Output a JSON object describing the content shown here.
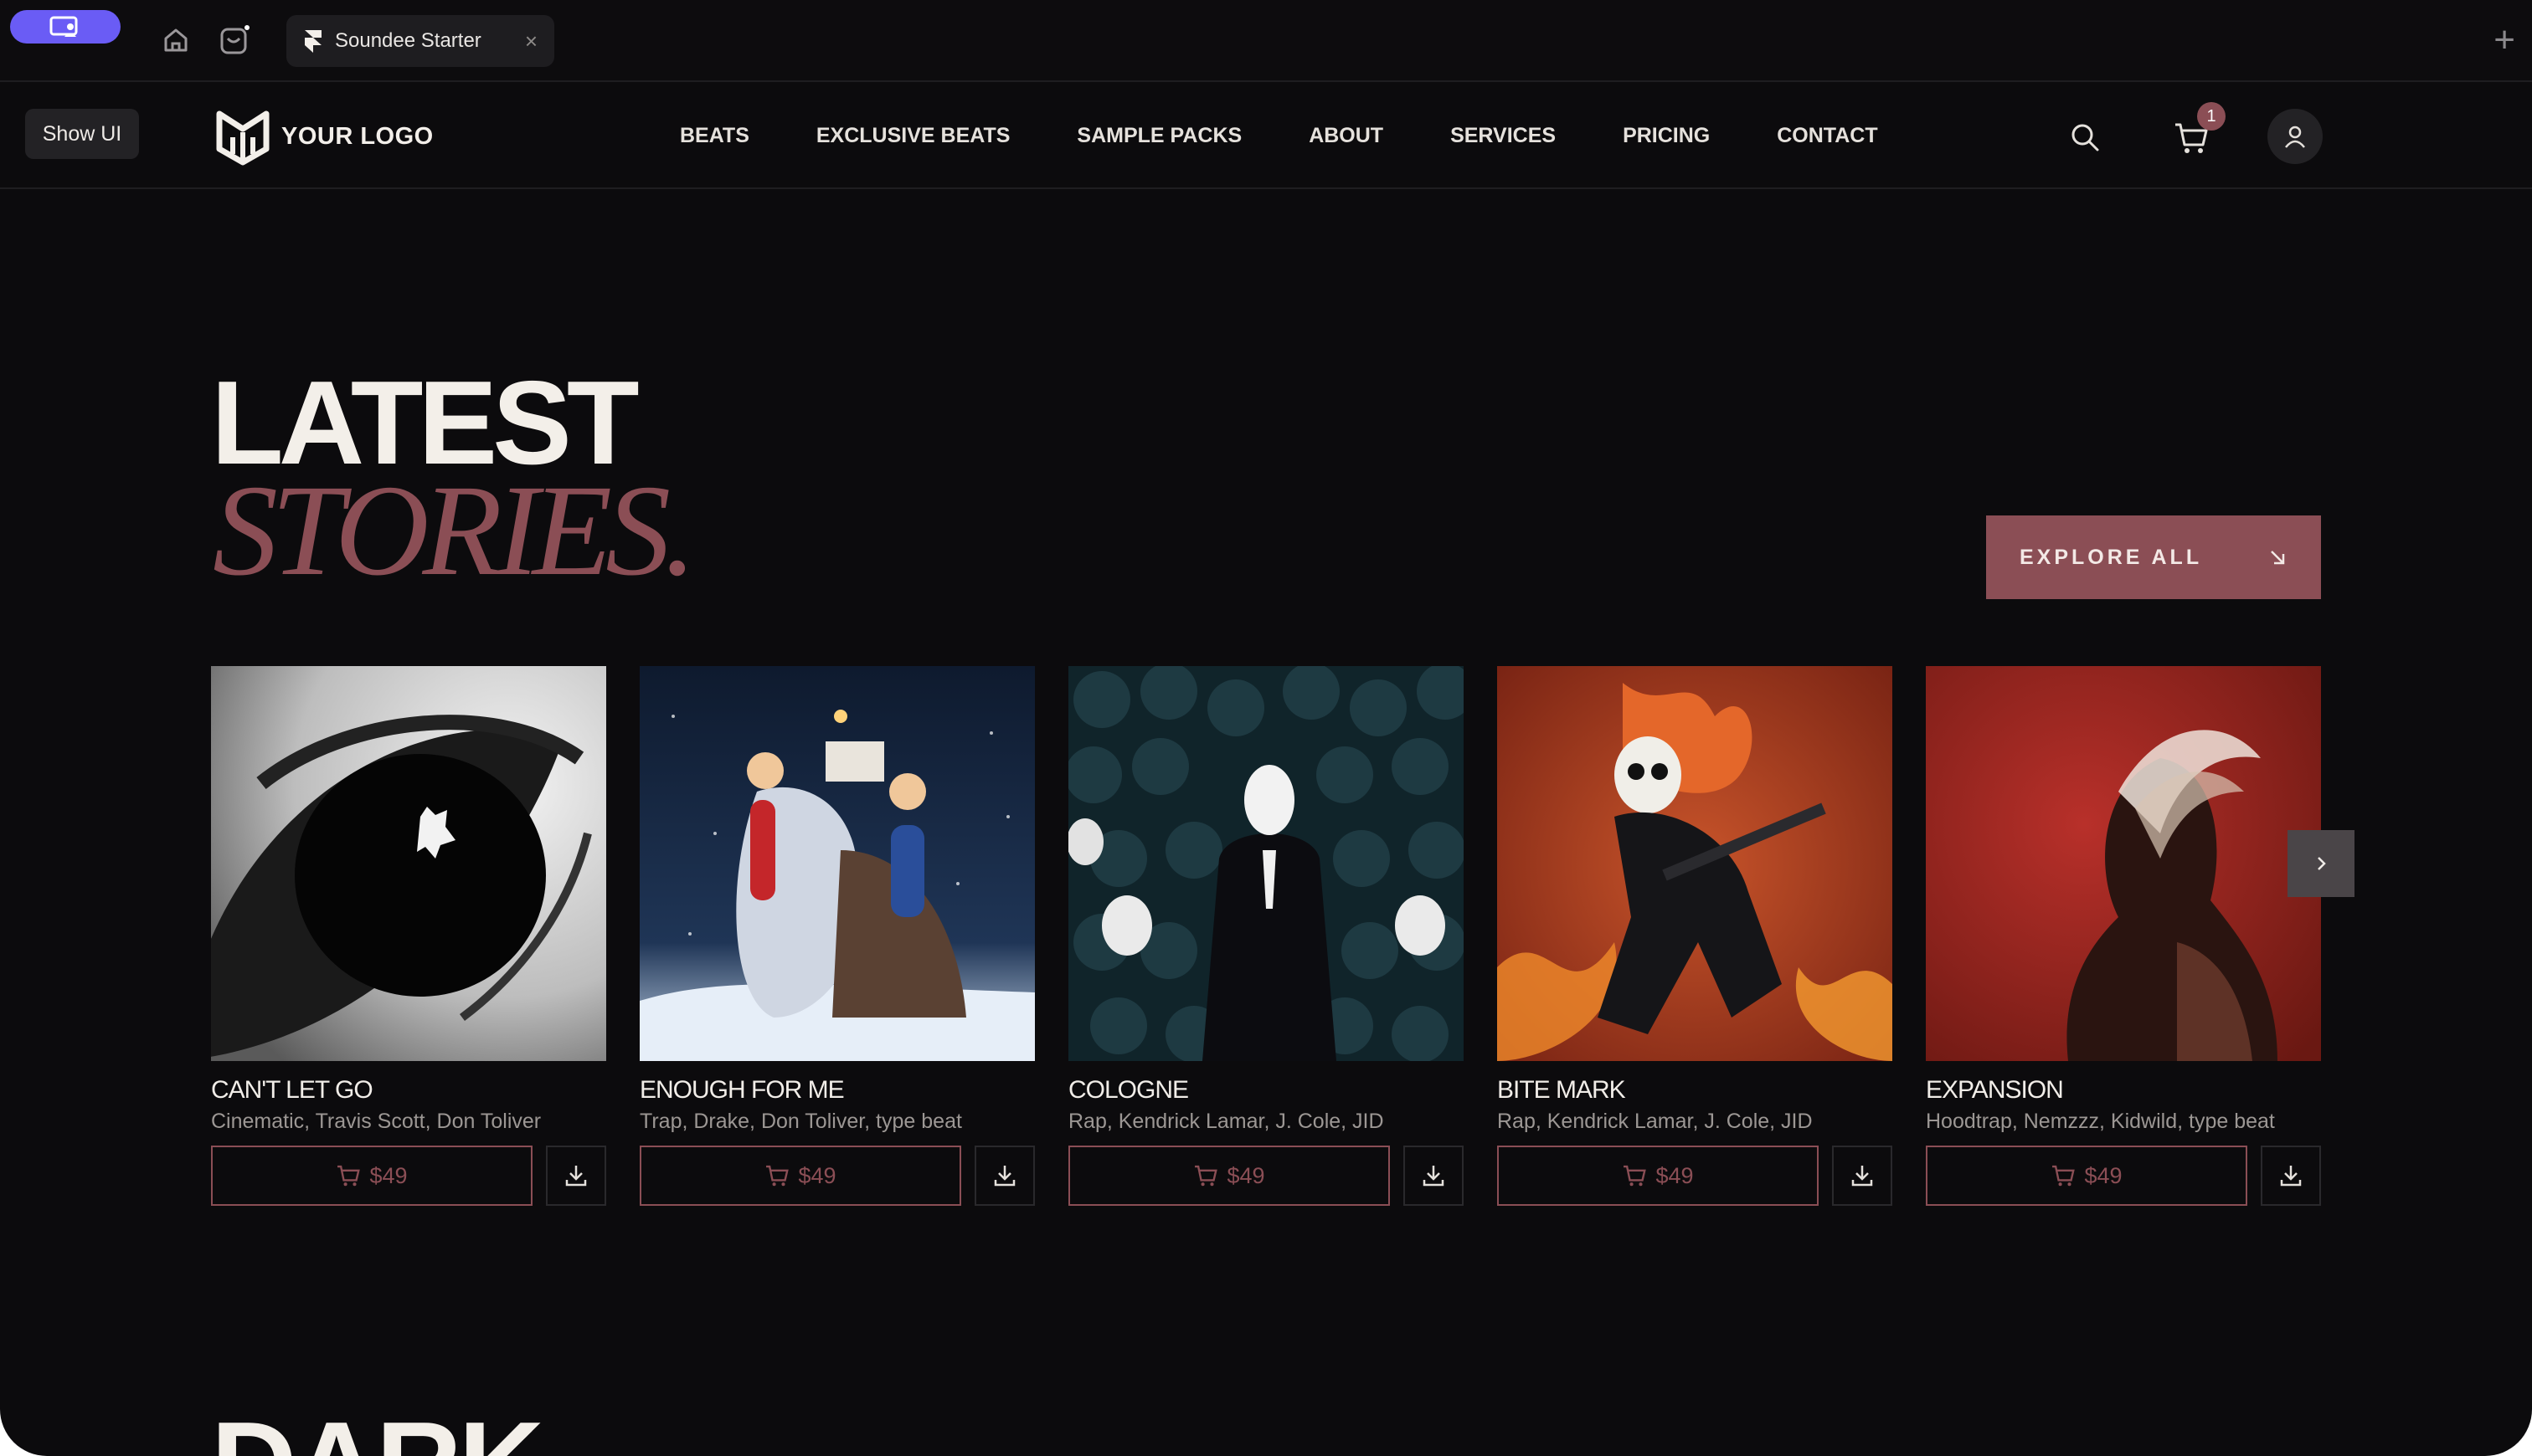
{
  "browser": {
    "tab_title": "Soundee Starter",
    "tab_close": "×",
    "new_tab": "+"
  },
  "nav": {
    "show_ui": "Show UI",
    "logo_text": "YOUR LOGO",
    "menu": [
      "BEATS",
      "EXCLUSIVE BEATS",
      "SAMPLE PACKS",
      "ABOUT",
      "SERVICES",
      "PRICING",
      "CONTACT"
    ],
    "cart_count": "1"
  },
  "hero": {
    "title_line1": "LATEST",
    "title_line2": "STORIES.",
    "explore_label": "EXPLORE ALL"
  },
  "cards": [
    {
      "title": "CAN'T LET GO",
      "tags": "Cinematic, Travis Scott, Don Toliver",
      "price": "$49"
    },
    {
      "title": "ENOUGH FOR ME",
      "tags": "Trap, Drake, Don Toliver, type beat",
      "price": "$49"
    },
    {
      "title": "COLOGNE",
      "tags": "Rap, Kendrick Lamar, J. Cole, JID",
      "price": "$49"
    },
    {
      "title": "BITE MARK",
      "tags": "Rap, Kendrick Lamar, J. Cole, JID",
      "price": "$49"
    },
    {
      "title": "EXPANSION",
      "tags": "Hoodtrap, Nemzzz, Kidwild, type beat",
      "price": "$49"
    }
  ],
  "next_section_heading": "DARK",
  "colors": {
    "accent": "#8b4e55",
    "background": "#0c0b0d",
    "launcher": "#6a5cf5"
  }
}
